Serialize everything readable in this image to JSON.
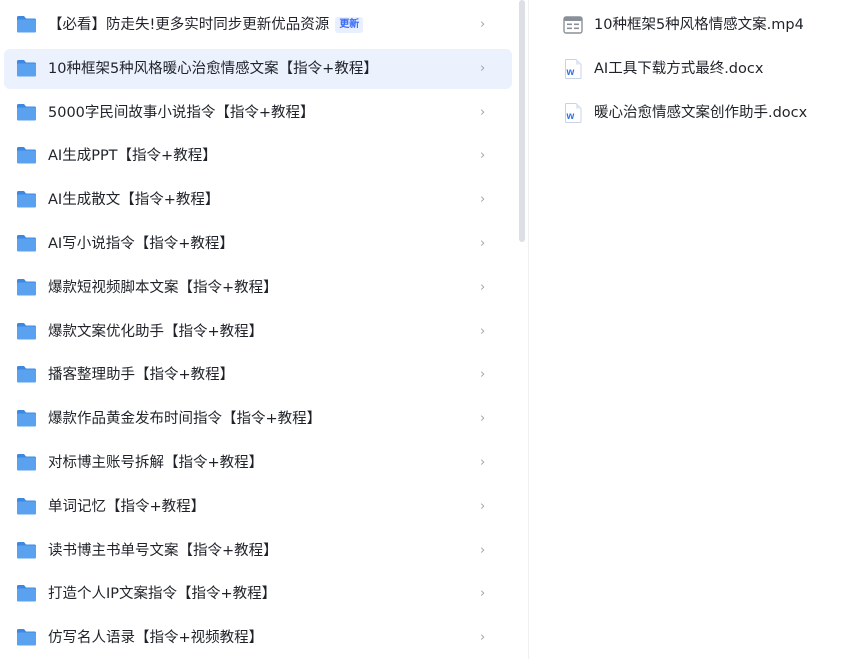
{
  "folders": [
    {
      "label": "【必看】防走失!更多实时同步更新优品资源",
      "badge": "更新",
      "selected": false
    },
    {
      "label": "10种框架5种风格暖心治愈情感文案【指令+教程】",
      "selected": true
    },
    {
      "label": "5000字民间故事小说指令【指令+教程】",
      "selected": false
    },
    {
      "label": "AI生成PPT【指令+教程】",
      "selected": false
    },
    {
      "label": "AI生成散文【指令+教程】",
      "selected": false
    },
    {
      "label": "AI写小说指令【指令+教程】",
      "selected": false
    },
    {
      "label": "爆款短视频脚本文案【指令+教程】",
      "selected": false
    },
    {
      "label": "爆款文案优化助手【指令+教程】",
      "selected": false
    },
    {
      "label": "播客整理助手【指令+教程】",
      "selected": false
    },
    {
      "label": "爆款作品黄金发布时间指令【指令+教程】",
      "selected": false
    },
    {
      "label": "对标博主账号拆解【指令+教程】",
      "selected": false
    },
    {
      "label": "单词记忆【指令+教程】",
      "selected": false
    },
    {
      "label": "读书博主书单号文案【指令+教程】",
      "selected": false
    },
    {
      "label": "打造个人IP文案指令【指令+教程】",
      "selected": false
    },
    {
      "label": "仿写名人语录【指令+视频教程】",
      "selected": false
    }
  ],
  "chevron_glyph": "›",
  "files": [
    {
      "name": "10种框架5种风格情感文案.mp4",
      "icon": "video-file-icon"
    },
    {
      "name": "AI工具下载方式最终.docx",
      "icon": "word-file-icon"
    },
    {
      "name": "暖心治愈情感文案创作助手.docx",
      "icon": "word-file-icon"
    }
  ],
  "colors": {
    "folder": "#5aa2f0",
    "folder_dark": "#3d88e0",
    "selected_bg": "#ecf1fe",
    "word_blue": "#2e6ee6",
    "badge_text": "#3b6cf5"
  }
}
